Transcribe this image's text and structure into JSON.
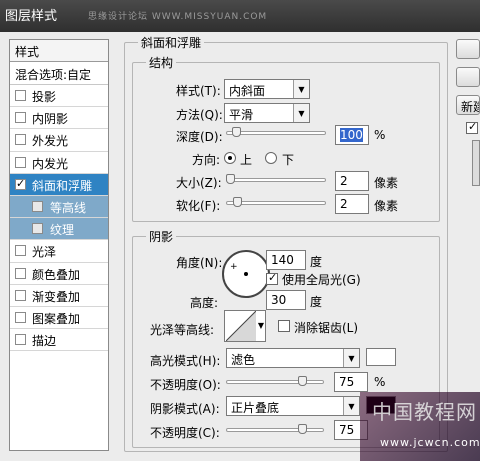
{
  "window": {
    "title": "图层样式",
    "watermark": "思缘设计论坛 WWW.MISSYUAN.COM"
  },
  "styles_panel": {
    "header": "样式",
    "blend_options": "混合选项:自定",
    "items": [
      {
        "label": "投影",
        "checked": false
      },
      {
        "label": "内阴影",
        "checked": false
      },
      {
        "label": "外发光",
        "checked": false
      },
      {
        "label": "内发光",
        "checked": false
      },
      {
        "label": "斜面和浮雕",
        "checked": true,
        "selected": true
      },
      {
        "label": "等高线",
        "checked": false,
        "sub": true
      },
      {
        "label": "纹理",
        "checked": false,
        "sub": true
      },
      {
        "label": "光泽",
        "checked": false
      },
      {
        "label": "颜色叠加",
        "checked": false
      },
      {
        "label": "渐变叠加",
        "checked": false
      },
      {
        "label": "图案叠加",
        "checked": false
      },
      {
        "label": "描边",
        "checked": false
      }
    ]
  },
  "bevel": {
    "group_title": "斜面和浮雕",
    "structure": {
      "title": "结构",
      "style_label": "样式(T):",
      "style_value": "内斜面",
      "technique_label": "方法(Q):",
      "technique_value": "平滑",
      "depth_label": "深度(D):",
      "depth_value": "100",
      "depth_unit": "%",
      "direction_label": "方向:",
      "direction_up": "上",
      "direction_down": "下",
      "size_label": "大小(Z):",
      "size_value": "2",
      "size_unit": "像素",
      "soften_label": "软化(F):",
      "soften_value": "2",
      "soften_unit": "像素"
    },
    "shading": {
      "title": "阴影",
      "angle_label": "角度(N):",
      "angle_value": "140",
      "angle_unit": "度",
      "global_light_label": "使用全局光(G)",
      "altitude_label": "高度:",
      "altitude_value": "30",
      "altitude_unit": "度",
      "gloss_contour_label": "光泽等高线:",
      "anti_aliased_label": "消除锯齿(L)",
      "highlight_mode_label": "高光模式(H):",
      "highlight_mode_value": "滤色",
      "highlight_opacity_label": "不透明度(O):",
      "highlight_opacity_value": "75",
      "highlight_opacity_unit": "%",
      "shadow_mode_label": "阴影模式(A):",
      "shadow_mode_value": "正片叠底",
      "shadow_opacity_label": "不透明度(C):",
      "shadow_opacity_value": "75"
    }
  },
  "right_buttons": {
    "new_style": "新建"
  },
  "bottom_watermark": {
    "text": "中国教程网",
    "url": "www.jcwcn.com"
  },
  "colors": {
    "selected": "#2f83c3",
    "sub_item": "#7fa9c9",
    "highlight_swatch": "#ffffff",
    "shadow_swatch": "#000000"
  }
}
